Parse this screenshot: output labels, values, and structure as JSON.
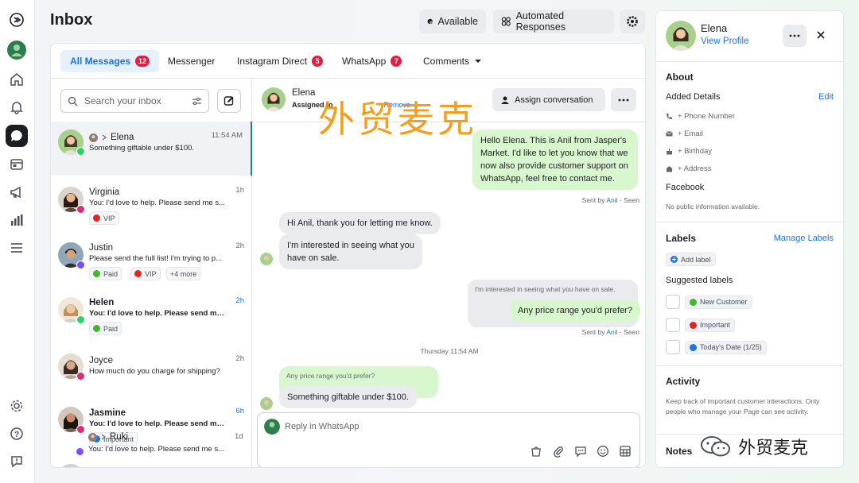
{
  "page": {
    "title": "Inbox"
  },
  "toolbar": {
    "available_label": "Available",
    "automated_label": "Automated Responses"
  },
  "tabs": [
    {
      "label": "All Messages",
      "badge": "12"
    },
    {
      "label": "Messenger",
      "badge": ""
    },
    {
      "label": "Instagram Direct",
      "badge": "5"
    },
    {
      "label": "WhatsApp",
      "badge": "7"
    },
    {
      "label": "Comments",
      "badge": ""
    }
  ],
  "search": {
    "placeholder": "Search your inbox"
  },
  "conversations": [
    {
      "name": "Elena",
      "time": "11:54 AM",
      "snippet": "Something giftable under $100.",
      "channel": "whatsapp",
      "tags": []
    },
    {
      "name": "Virginia",
      "time": "1h",
      "snippet": "You: I'd love to help. Please send me s...",
      "channel": "instagram",
      "tags": [
        {
          "label": "VIP",
          "color": "#e0271b"
        }
      ]
    },
    {
      "name": "Justin",
      "time": "2h",
      "snippet": "Please send the full list! I'm trying to p...",
      "channel": "messenger",
      "tags": [
        {
          "label": "Paid",
          "color": "#42b72a"
        },
        {
          "label": "VIP",
          "color": "#e0271b"
        },
        {
          "label": "+4 more",
          "color": ""
        }
      ]
    },
    {
      "name": "Helen",
      "time": "2h",
      "snippet": "You: I'd love to help. Please send me s...",
      "channel": "whatsapp",
      "tags": [
        {
          "label": "Paid",
          "color": "#42b72a"
        }
      ]
    },
    {
      "name": "Joyce",
      "time": "2h",
      "snippet": "How much do you charge for shipping?",
      "channel": "instagram",
      "tags": []
    },
    {
      "name": "Jasmine",
      "time": "6h",
      "snippet": "You: I'd love to help. Please send me s...",
      "channel": "instagram",
      "tags": [
        {
          "label": "Important",
          "color": "#1b74e4"
        }
      ]
    },
    {
      "name": "Ruki",
      "time": "1d",
      "snippet": "You: I'd love to help. Please send me s...",
      "channel": "messenger",
      "tags": []
    }
  ],
  "chat": {
    "contact_name": "Elena",
    "assigned_text": "Assigned to",
    "remove_text": "Remove",
    "assign_label": "Assign conversation",
    "messages": {
      "m1": "Hello Elena. This is Anil from Jasper's Market. I'd like to let you know that we now also provide customer support on WhatsApp, feel free to contact me.",
      "m1_meta_prefix": "Sent by",
      "m1_meta_name": "Anil",
      "m1_meta_suffix": "· Seen",
      "m2": "Hi Anil, thank you for letting me know.",
      "m3": "I'm interested in seeing what you have on sale.",
      "m4_quote": "I'm interested in seeing what you have on sale.",
      "m4": "Any price range you'd prefer?",
      "m4_meta_prefix": "Sent by",
      "m4_meta_name": "Anil",
      "m4_meta_suffix": "· Seen",
      "date": "Thursday 11:54 AM",
      "m5_quote": "Any price range you'd prefer?",
      "m5": "Something giftable under $100."
    },
    "reply_placeholder": "Reply in WhatsApp"
  },
  "profile": {
    "name": "Elena",
    "view_profile": "View Profile"
  },
  "about": {
    "title": "About",
    "added_details": "Added Details",
    "edit": "Edit",
    "phone": "+ Phone Number",
    "email": "+ Email",
    "birthday": "+ Birthday",
    "address": "+ Address",
    "facebook_title": "Facebook",
    "facebook_text": "No public information available."
  },
  "labels": {
    "title": "Labels",
    "manage": "Manage Labels",
    "add": "Add label",
    "suggested_title": "Suggested labels",
    "suggested": [
      {
        "label": "New Customer",
        "color": "#42b72a"
      },
      {
        "label": "Important",
        "color": "#e0271b"
      },
      {
        "label": "Today's Date (1/25)",
        "color": "#1b74e4"
      }
    ]
  },
  "activity": {
    "title": "Activity",
    "text": "Keep track of important customer interactions. Only people who manage your Page can see activity."
  },
  "notes": {
    "title": "Notes"
  },
  "watermarks": {
    "overlay": "外贸麦克",
    "corner": "外贸麦克"
  },
  "colors": {
    "accent": "#1b74e4",
    "badge": "#e41e3f",
    "outgoing": "#d9f7cf"
  }
}
